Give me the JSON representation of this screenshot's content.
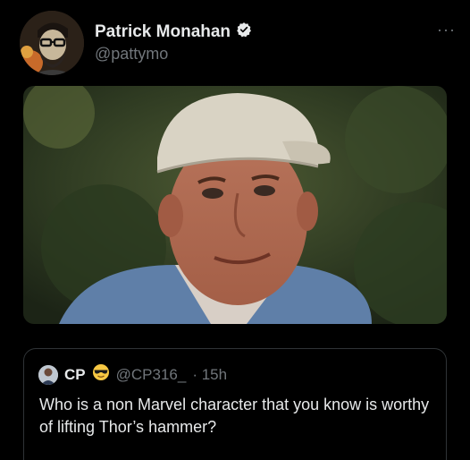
{
  "tweet": {
    "author_name": "Patrick Monahan",
    "author_handle": "@pattymo",
    "more_label": "···",
    "verified": true
  },
  "media": {
    "description_icon": "photo-of-man-in-cap"
  },
  "quoted": {
    "author_name": "CP",
    "emoji": "sunglasses-emoji",
    "author_handle": "@CP316_",
    "time": "· 15h",
    "text": "Who is a non Marvel character that you know is worthy of lifting Thor’s hammer?"
  },
  "colors": {
    "background": "#000000",
    "text": "#e7e9ea",
    "muted": "#71767b",
    "border": "#2f3336"
  }
}
